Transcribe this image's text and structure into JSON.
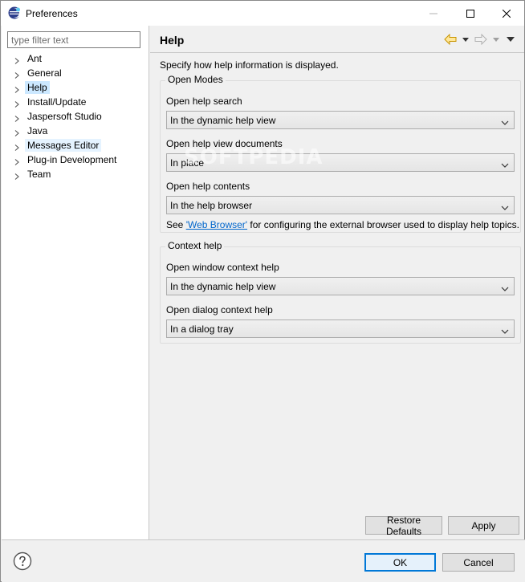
{
  "window": {
    "title": "Preferences",
    "minimize_glyph": "—",
    "maximize_glyph": "☐",
    "close_glyph": "✕"
  },
  "sidebar": {
    "filter_placeholder": "type filter text",
    "items": [
      {
        "label": "Ant",
        "state": "normal"
      },
      {
        "label": "General",
        "state": "normal"
      },
      {
        "label": "Help",
        "state": "selected"
      },
      {
        "label": "Install/Update",
        "state": "normal"
      },
      {
        "label": "Jaspersoft Studio",
        "state": "normal"
      },
      {
        "label": "Java",
        "state": "normal"
      },
      {
        "label": "Messages Editor",
        "state": "hover"
      },
      {
        "label": "Plug-in Development",
        "state": "normal"
      },
      {
        "label": "Team",
        "state": "normal"
      }
    ]
  },
  "page": {
    "title": "Help",
    "description": "Specify how help information is displayed.",
    "open_modes": {
      "title": "Open Modes",
      "help_search_label": "Open help search",
      "help_search_value": "In the dynamic help view",
      "view_documents_label": "Open help view documents",
      "view_documents_value": "In place",
      "contents_label": "Open help contents",
      "contents_value": "In the help browser",
      "see_prefix": "See ",
      "see_link": "'Web Browser'",
      "see_suffix": " for configuring the external browser used to display help topics."
    },
    "context_help": {
      "title": "Context help",
      "window_label": "Open window context help",
      "window_value": "In the dynamic help view",
      "dialog_label": "Open dialog context help",
      "dialog_value": "In a dialog tray"
    },
    "restore_defaults_label": "Restore Defaults",
    "apply_label": "Apply"
  },
  "footer": {
    "ok_label": "OK",
    "cancel_label": "Cancel"
  },
  "watermark": "SOFTPEDIA",
  "colors": {
    "selected_item": "#cce8ff",
    "hover_item": "#e5f3ff",
    "link": "#0066cc",
    "nav_arrow_active": "#e8b400",
    "default_button_border": "#0078d7"
  }
}
